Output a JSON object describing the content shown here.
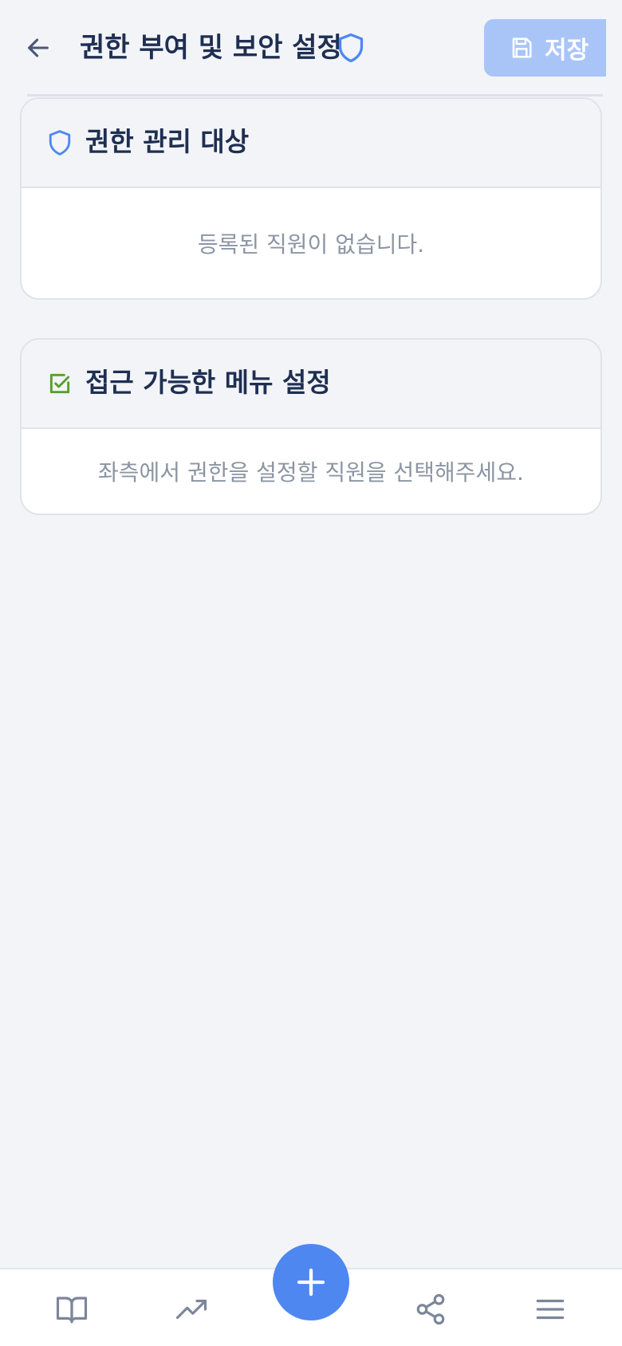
{
  "header": {
    "title": "권한 부여 및 보안 설정",
    "save_label": "저장"
  },
  "cards": {
    "targets": {
      "title": "권한 관리 대상",
      "empty_text": "등록된 직원이 없습니다."
    },
    "menus": {
      "title": "접근 가능한 메뉴 설정",
      "empty_text": "좌측에서 권한을 설정할 직원을 선택해주세요."
    }
  },
  "bottom_nav": {
    "items": [
      "book-icon",
      "trending-up-icon",
      "add-icon",
      "share-icon",
      "menu-icon"
    ]
  },
  "colors": {
    "accent": "#4f87f1",
    "save_button_disabled": "#a9c5f8",
    "check_green": "#5a9e2e",
    "title_text": "#1f2f52",
    "muted_text": "#8c95a3",
    "background": "#f2f4f7"
  }
}
